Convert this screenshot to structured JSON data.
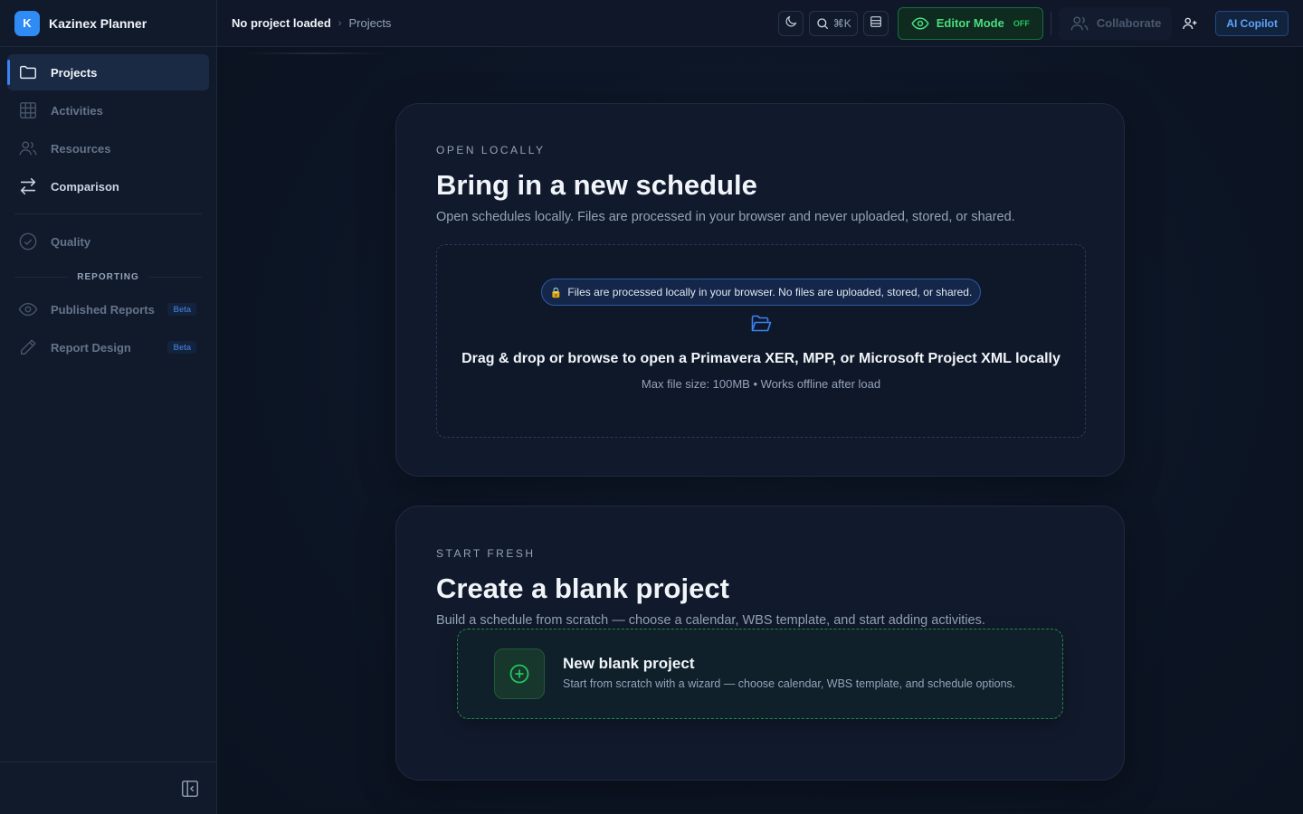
{
  "app": {
    "name": "Kazinex Planner",
    "logo_letter": "K"
  },
  "sidebar": {
    "items": [
      {
        "label": "Projects",
        "icon": "folder-icon",
        "active": true
      },
      {
        "label": "Activities",
        "icon": "table-grid-icon"
      },
      {
        "label": "Resources",
        "icon": "users-icon"
      },
      {
        "label": "Comparison",
        "icon": "swap-arrows-icon"
      },
      {
        "label": "Quality",
        "icon": "check-circle-icon"
      }
    ],
    "reporting_label": "REPORTING",
    "reporting_items": [
      {
        "label": "Published Reports",
        "icon": "eye-icon",
        "badge": "Beta"
      },
      {
        "label": "Report Design",
        "icon": "pencil-icon",
        "badge": "Beta"
      }
    ]
  },
  "topbar": {
    "breadcrumb_current": "No project loaded",
    "breadcrumb_separator": "›",
    "breadcrumb_page": "Projects",
    "search_shortcut": "⌘K",
    "editor_mode_label": "Editor Mode",
    "editor_mode_state": "OFF",
    "collaborate_label": "Collaborate",
    "copilot_label": "AI Copilot"
  },
  "open_card": {
    "eyebrow": "OPEN LOCALLY",
    "title": "Bring in a new schedule",
    "subtitle": "Open schedules locally. Files are processed in your browser and never uploaded, stored, or shared.",
    "privacy_notice": "Files are processed locally in your browser. No files are uploaded, stored, or shared.",
    "dropzone_title": "Drag & drop or browse to open a Primavera XER, MPP, or Microsoft Project XML locally",
    "dropzone_sub": "Max file size: 100MB • Works offline after load"
  },
  "blank_card": {
    "eyebrow": "START FRESH",
    "title": "Create a blank project",
    "subtitle": "Build a schedule from scratch — choose a calendar, WBS template, and start adding activities.",
    "button_title": "New blank project",
    "button_sub": "Start from scratch with a wizard — choose calendar, WBS template, and schedule options."
  },
  "colors": {
    "accent": "#3b82f6",
    "editor_green": "#4ade80",
    "background": "#0b1220"
  }
}
